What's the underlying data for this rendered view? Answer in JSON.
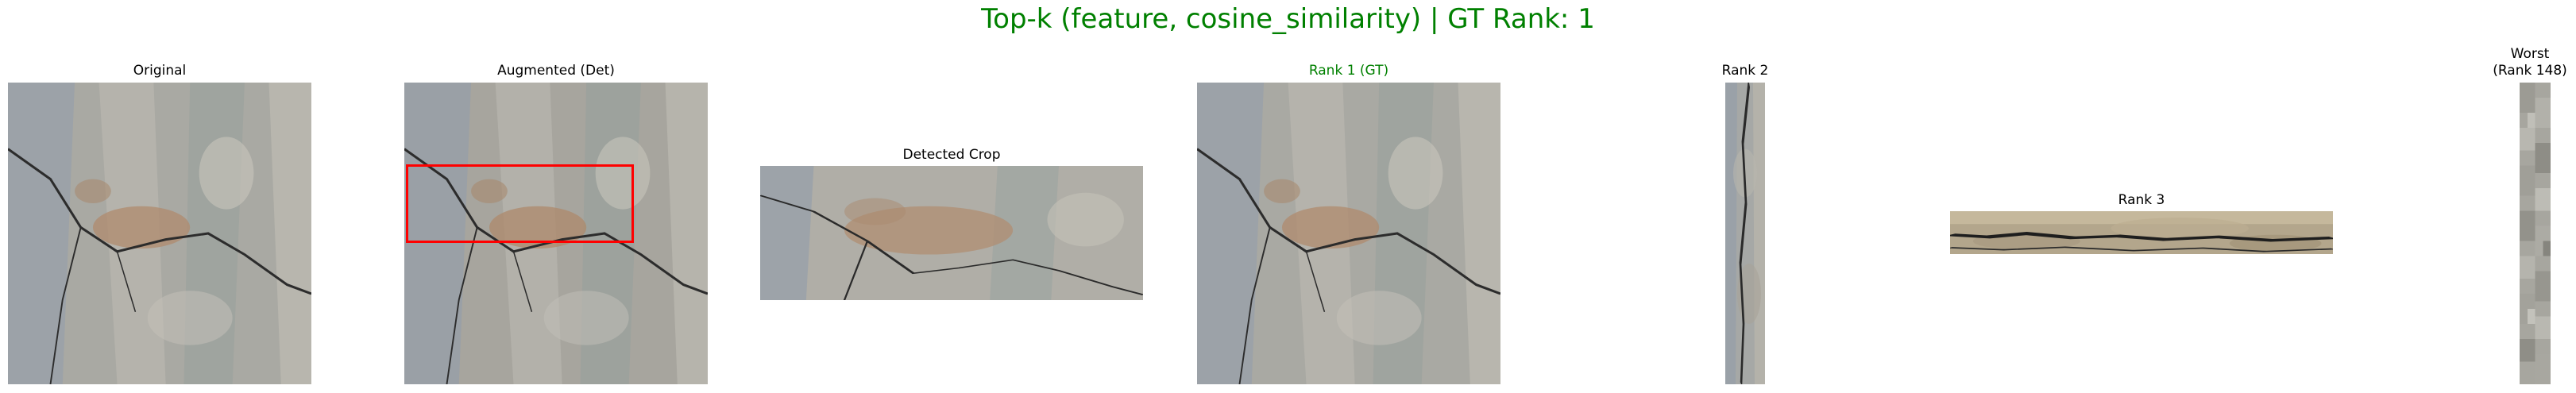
{
  "figure": {
    "title": "Top-k (feature, cosine_similarity) | GT Rank: 1",
    "title_color": "#008000",
    "gt_color": "#008000",
    "bbox_color": "#ff0000"
  },
  "panels": [
    {
      "id": "original",
      "title": "Original",
      "content": "rock-texture-image"
    },
    {
      "id": "augmented",
      "title": "Augmented (Det)",
      "content": "rock-texture-image-with-detection-box"
    },
    {
      "id": "detected-crop",
      "title": "Detected Crop",
      "content": "cropped-rock-texture-image"
    },
    {
      "id": "rank-1",
      "title": "Rank 1 (GT)",
      "is_ground_truth": true,
      "content": "rock-texture-image"
    },
    {
      "id": "rank-2",
      "title": "Rank 2",
      "content": "narrow-vertical-rock-texture-image"
    },
    {
      "id": "rank-3",
      "title": "Rank 3",
      "content": "wide-horizontal-cracked-stone-image"
    },
    {
      "id": "worst",
      "title_line1": "Worst",
      "title_line2": "(Rank 148)",
      "content": "narrow-vertical-pixelated-gray-image"
    }
  ]
}
